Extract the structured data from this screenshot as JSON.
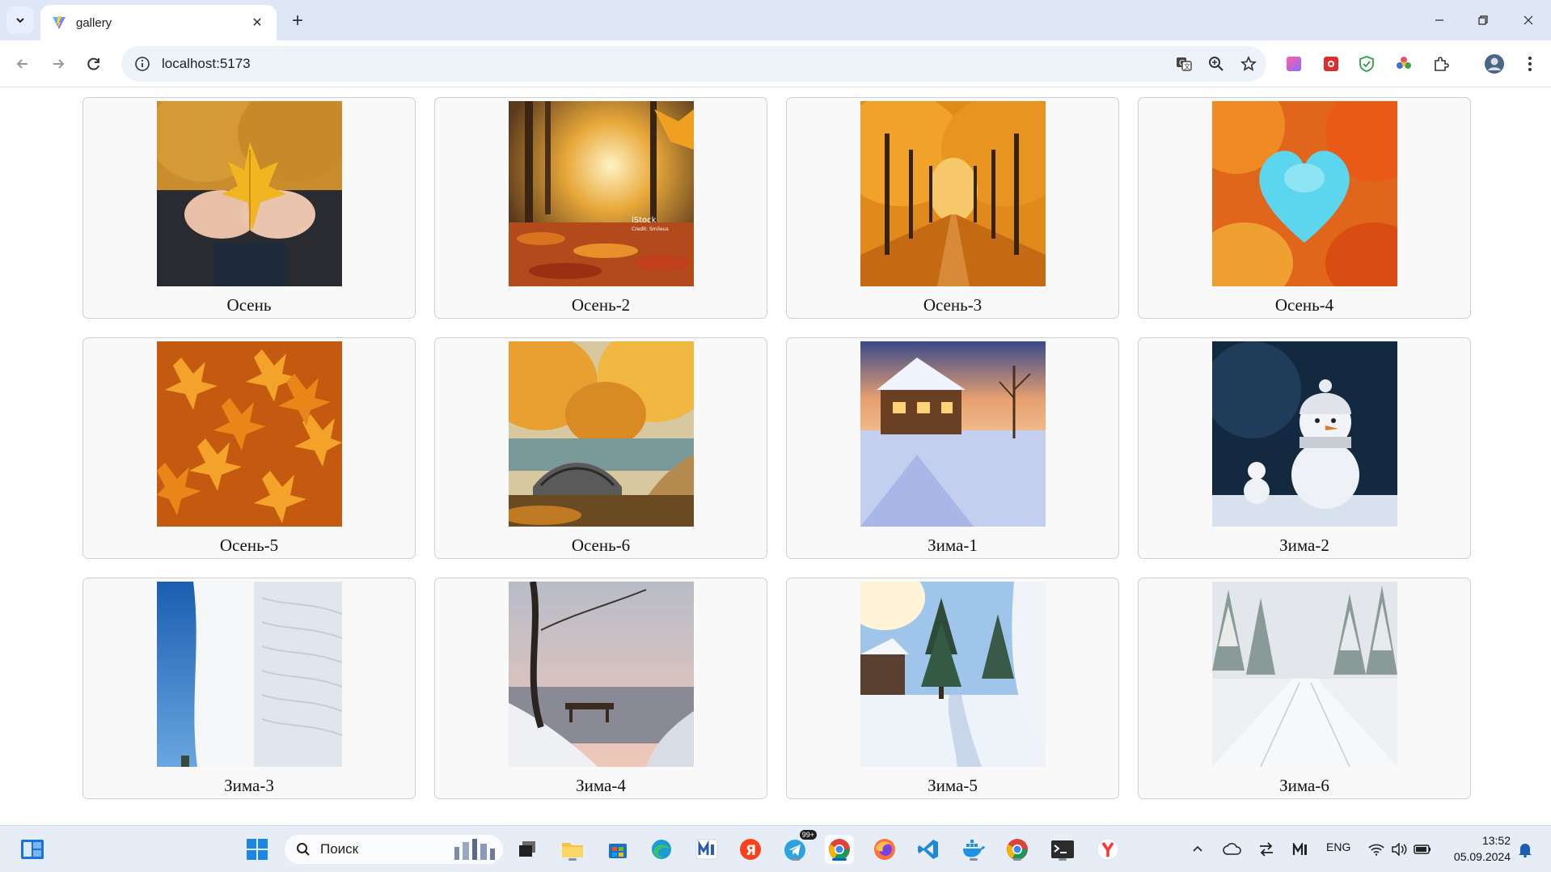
{
  "browser": {
    "tab_title": "gallery",
    "url": "localhost:5173"
  },
  "gallery": {
    "items": [
      {
        "label": "Осень"
      },
      {
        "label": "Осень-2"
      },
      {
        "label": "Осень-3"
      },
      {
        "label": "Осень-4"
      },
      {
        "label": "Осень-5"
      },
      {
        "label": "Осень-6"
      },
      {
        "label": "Зима-1"
      },
      {
        "label": "Зима-2"
      },
      {
        "label": "Зима-3"
      },
      {
        "label": "Зима-4"
      },
      {
        "label": "Зима-5"
      },
      {
        "label": "Зима-6"
      }
    ]
  },
  "watermark": {
    "text": "iStock",
    "credit": "Credit: Smileus"
  },
  "taskbar": {
    "search_placeholder": "Поиск",
    "telegram_badge": "99+",
    "language": "ENG",
    "time": "13:52",
    "date": "05.09.2024"
  },
  "colors": {
    "accent": "#0067c0",
    "tabstrip": "#dfe6f5",
    "card_bg": "#f9f9f9",
    "card_border": "#cfcfcf"
  }
}
